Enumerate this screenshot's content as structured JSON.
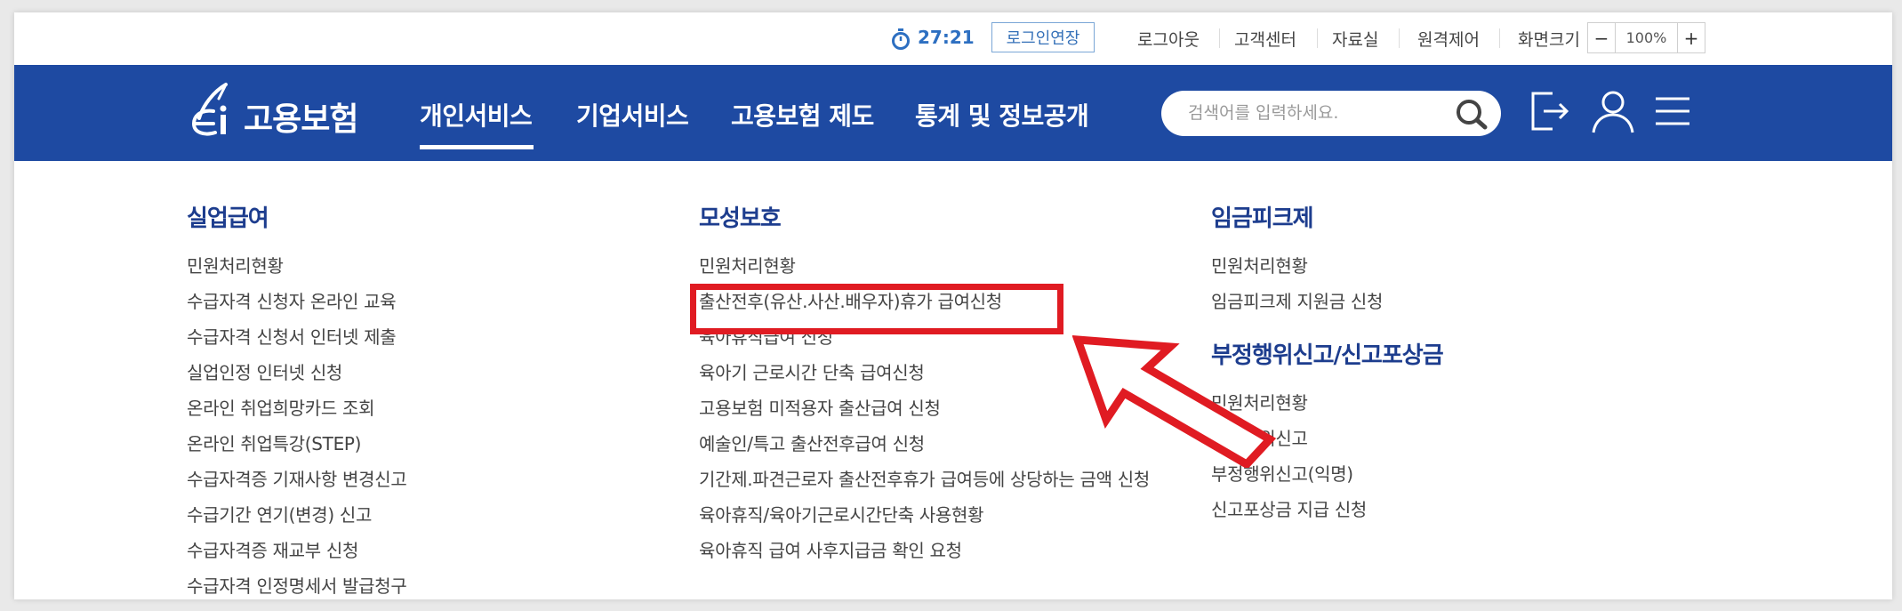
{
  "util": {
    "timer": "27:21",
    "extend_login": "로그인연장",
    "links": [
      "로그아웃",
      "고객센터",
      "자료실",
      "원격제어",
      "화면크기"
    ],
    "zoom_minus": "−",
    "zoom_value": "100%",
    "zoom_plus": "+"
  },
  "header": {
    "logo_text": "고용보험",
    "menus": [
      "개인서비스",
      "기업서비스",
      "고용보험 제도",
      "통계 및 정보공개"
    ],
    "active_menu_index": 0,
    "search_placeholder": "검색어를 입력하세요.",
    "icons": [
      "search-icon",
      "logout-icon",
      "user-icon",
      "hamburger-menu-icon"
    ],
    "brand_color": "#1e4aa2"
  },
  "mega_menu": {
    "unemployment": {
      "title": "실업급여",
      "items": [
        "민원처리현황",
        "수급자격 신청자 온라인 교육",
        "수급자격 신청서 인터넷 제출",
        "실업인정 인터넷 신청",
        "온라인 취업희망카드 조회",
        "온라인 취업특강(STEP)",
        "수급자격증 기재사항 변경신고",
        "수급기간 연기(변경) 신고",
        "수급자격증 재교부 신청",
        "수급자격 인정명세서 발급청구"
      ]
    },
    "maternity": {
      "title": "모성보호",
      "items": [
        "민원처리현황",
        "출산전후(유산.사산.배우자)휴가 급여신청",
        "육아휴직급여 신청",
        "육아기 근로시간 단축 급여신청",
        "고용보험 미적용자 출산급여 신청",
        "예술인/특고 출산전후급여 신청",
        "기간제.파견근로자 출산전후휴가 급여등에 상당하는 금액 신청",
        "육아휴직/육아기근로시간단축 사용현황",
        "육아휴직 급여 사후지급금 확인 요청"
      ],
      "highlighted_index": 1
    },
    "wage_peak": {
      "title": "임금피크제",
      "items": [
        "민원처리현황",
        "임금피크제 지원금 신청"
      ]
    },
    "fraud_report": {
      "title": "부정행위신고/신고포상금",
      "items": [
        "민원처리현황",
        "부정행위신고",
        "부정행위신고(익명)",
        "신고포상금 지급 신청"
      ]
    }
  },
  "annotation": {
    "highlight_color": "#e01b22"
  }
}
